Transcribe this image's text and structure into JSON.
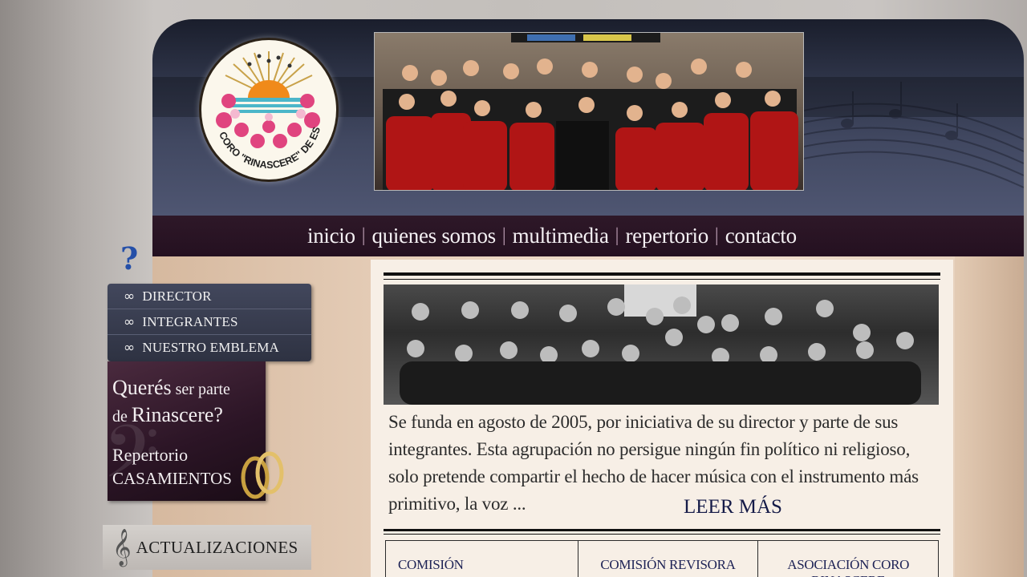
{
  "header": {
    "logo_text": "CORO \"RINASCERE\" DE ESCOBAR"
  },
  "nav": {
    "items": [
      {
        "label": "inicio"
      },
      {
        "label": "quienes somos"
      },
      {
        "label": "multimedia"
      },
      {
        "label": "repertorio"
      },
      {
        "label": "contacto"
      }
    ]
  },
  "sidebar": {
    "help_mark": "?",
    "items": [
      {
        "label": "DIRECTOR"
      },
      {
        "label": "INTEGRANTES"
      },
      {
        "label": "NUESTRO EMBLEMA"
      }
    ],
    "promo": {
      "line1_big": "Querés",
      "line1_small": " ser parte",
      "line2_small": "de ",
      "line2_big": "Rinascere?",
      "line3": "Repertorio",
      "line4": "CASAMIENTOS"
    },
    "updates_label": "ACTUALIZACIONES"
  },
  "main": {
    "intro_text": "Se funda en agosto de 2005, por iniciativa de su director y parte de sus integrantes. Esta agrupación no persigue ningún fin político ni religioso, solo pretende compartir el hecho de hacer música con el instrumento más primitivo, la voz ...",
    "read_more": "LEER MÁS",
    "tabs": [
      {
        "label": "COMISIÓN"
      },
      {
        "label": "COMISIÓN REVISORA"
      },
      {
        "label": "ASOCIACIÓN CORO RINASCERE"
      }
    ]
  },
  "colors": {
    "nav_bg": "#2e1828",
    "header_bg": "#2e3448",
    "link_dark_blue": "#151b48",
    "help_blue": "#244fa8"
  }
}
